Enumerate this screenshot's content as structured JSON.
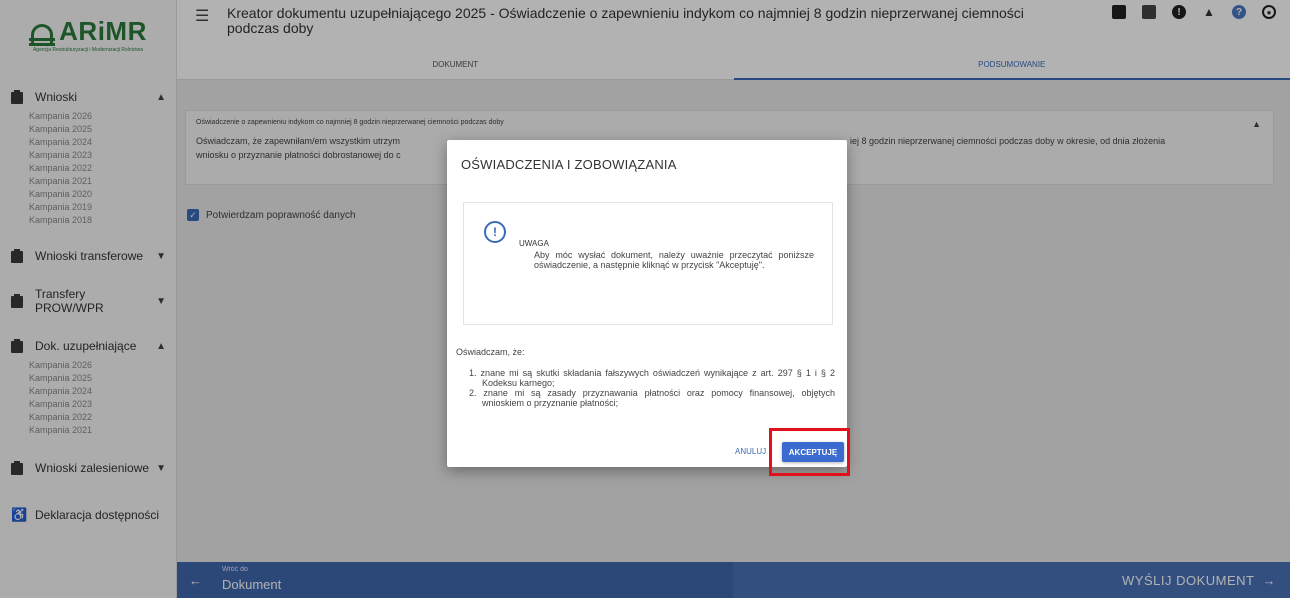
{
  "app": {
    "logo_text": "ARiMR",
    "logo_subtitle": "Agencja Restrukturyzacji i Modernizacji Rolnictwa"
  },
  "header": {
    "title": "Kreator dokumentu uzupełniającego 2025 - Oświadczenie o zapewnieniu indykom co najmniej 8 godzin nieprzerwanej ciemności podczas doby",
    "tabs": [
      {
        "label": "DOKUMENT",
        "active": false
      },
      {
        "label": "PODSUMOWANIE",
        "active": true
      }
    ],
    "icons": [
      "save-icon",
      "print-icon",
      "alert-icon",
      "bell-icon",
      "help-icon",
      "user-icon"
    ]
  },
  "sidebar": {
    "groups": [
      {
        "label": "Wnioski",
        "expanded": true,
        "items": [
          "Kampania 2026",
          "Kampania 2025",
          "Kampania 2024",
          "Kampania 2023",
          "Kampania 2022",
          "Kampania 2021",
          "Kampania 2020",
          "Kampania 2019",
          "Kampania 2018"
        ]
      },
      {
        "label": "Wnioski transferowe",
        "expanded": false,
        "items": []
      },
      {
        "label": "Transfery PROW/WPR",
        "expanded": false,
        "items": []
      },
      {
        "label": "Dok. uzupełniające",
        "expanded": true,
        "items": [
          "Kampania 2026",
          "Kampania 2025",
          "Kampania 2024",
          "Kampania 2023",
          "Kampania 2022",
          "Kampania 2021"
        ]
      },
      {
        "label": "Wnioski zalesieniowe",
        "expanded": false,
        "items": []
      },
      {
        "label": "Deklaracja dostępności",
        "expanded": false,
        "items": []
      }
    ]
  },
  "main": {
    "card_title": "Oświadczenie o zapewnieniu indykom co najmniej 8 godzin nieprzerwanej ciemności podczas doby",
    "card_text_left": "Oświadczam, że zapewniłam/em wszystkim utrzym",
    "card_text_right": "iej 8 godzin nieprzerwanej ciemności podczas doby w okresie, od dnia złożenia",
    "card_text_line2": "wniosku o przyznanie płatności dobrostanowej do c",
    "confirm_label": "Potwierdzam poprawność danych",
    "confirm_checked": true
  },
  "bottom": {
    "back_small": "Wróć do",
    "back_label": "Dokument",
    "send_label": "WYŚLIJ DOKUMENT"
  },
  "modal": {
    "title": "OŚWIADCZENIA I ZOBOWIĄZANIA",
    "notice_icon_glyph": "!",
    "notice_title": "UWAGA",
    "notice_text": "Aby móc wysłać dokument, należy uważnie przeczytać poniższe oświadczenie, a następnie kliknąć w przycisk \"Akceptuję\".",
    "declaration_intro": "Oświadczam, że:",
    "declarations": [
      "1. znane mi są skutki składania fałszywych oświadczeń wynikające z art. 297 § 1 i § 2 Kodeksu karnego;",
      "2. znane mi są zasady przyznawania płatności oraz pomocy finansowej, objętych wnioskiem o przyznanie płatności;"
    ],
    "cancel_label": "ANULUJ",
    "accept_label": "AKCEPTUJĘ",
    "highlight_color": "#e0111a"
  }
}
